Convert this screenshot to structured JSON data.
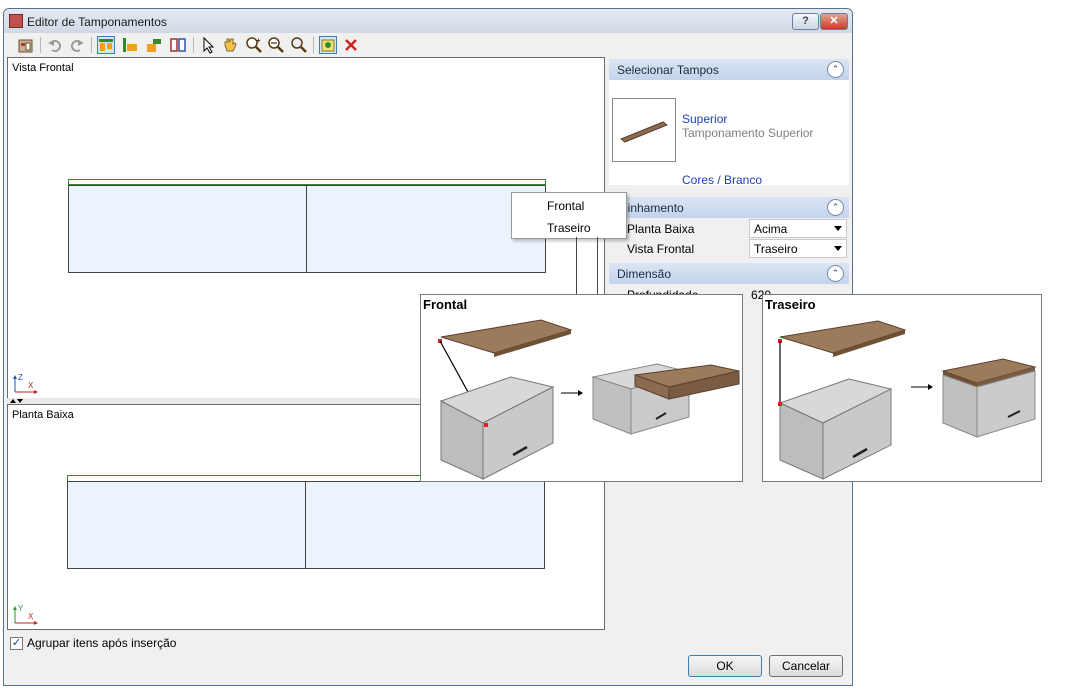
{
  "window": {
    "title": "Editor de Tamponamentos",
    "help_label": "?",
    "close_label": "✕"
  },
  "toolbar": {
    "icons": [
      "new-icon",
      "undo-icon",
      "redo-icon",
      "align-top-icon",
      "align-left-icon",
      "align-corner-icon",
      "side-by-side-icon",
      "select-arrow-icon",
      "pan-hand-icon",
      "zoom-in-icon",
      "zoom-out-icon",
      "zoom-fit-icon",
      "insert-top-icon",
      "delete-icon"
    ]
  },
  "views": {
    "front_label": "Vista Frontal",
    "plan_label": "Planta Baixa",
    "front_axes": {
      "vertical": "Z",
      "horizontal": "X"
    },
    "plan_axes": {
      "vertical": "Y",
      "horizontal": "X"
    }
  },
  "panel": {
    "select_header": "Selecionar Tampos",
    "item_name": "Superior",
    "item_desc": "Tamponamento Superior",
    "item_color": "Cores / Branco",
    "alignment_header": "Alinhamento",
    "alignment_rows": [
      {
        "label": "Planta Baixa",
        "value": "Acima"
      },
      {
        "label": "Vista Frontal",
        "value": "Traseiro"
      }
    ],
    "dimension_header": "Dimensão",
    "dimension_rows": [
      {
        "label": "Profundidade",
        "value": "620"
      }
    ]
  },
  "dropdown": {
    "options": [
      "Frontal",
      "Traseiro"
    ]
  },
  "tooltips": {
    "frontal_title": "Frontal",
    "traseiro_title": "Traseiro"
  },
  "footer": {
    "group_checkbox_label": "Agrupar itens após inserção",
    "group_checked": true,
    "ok_label": "OK",
    "cancel_label": "Cancelar"
  },
  "colors": {
    "cabinet_fill": "#ebf3fd",
    "top_line": "#2e8b2e",
    "panel_header": "#c3d3e9",
    "link_text": "#1f3fb5",
    "wood": "#8a6a50"
  }
}
